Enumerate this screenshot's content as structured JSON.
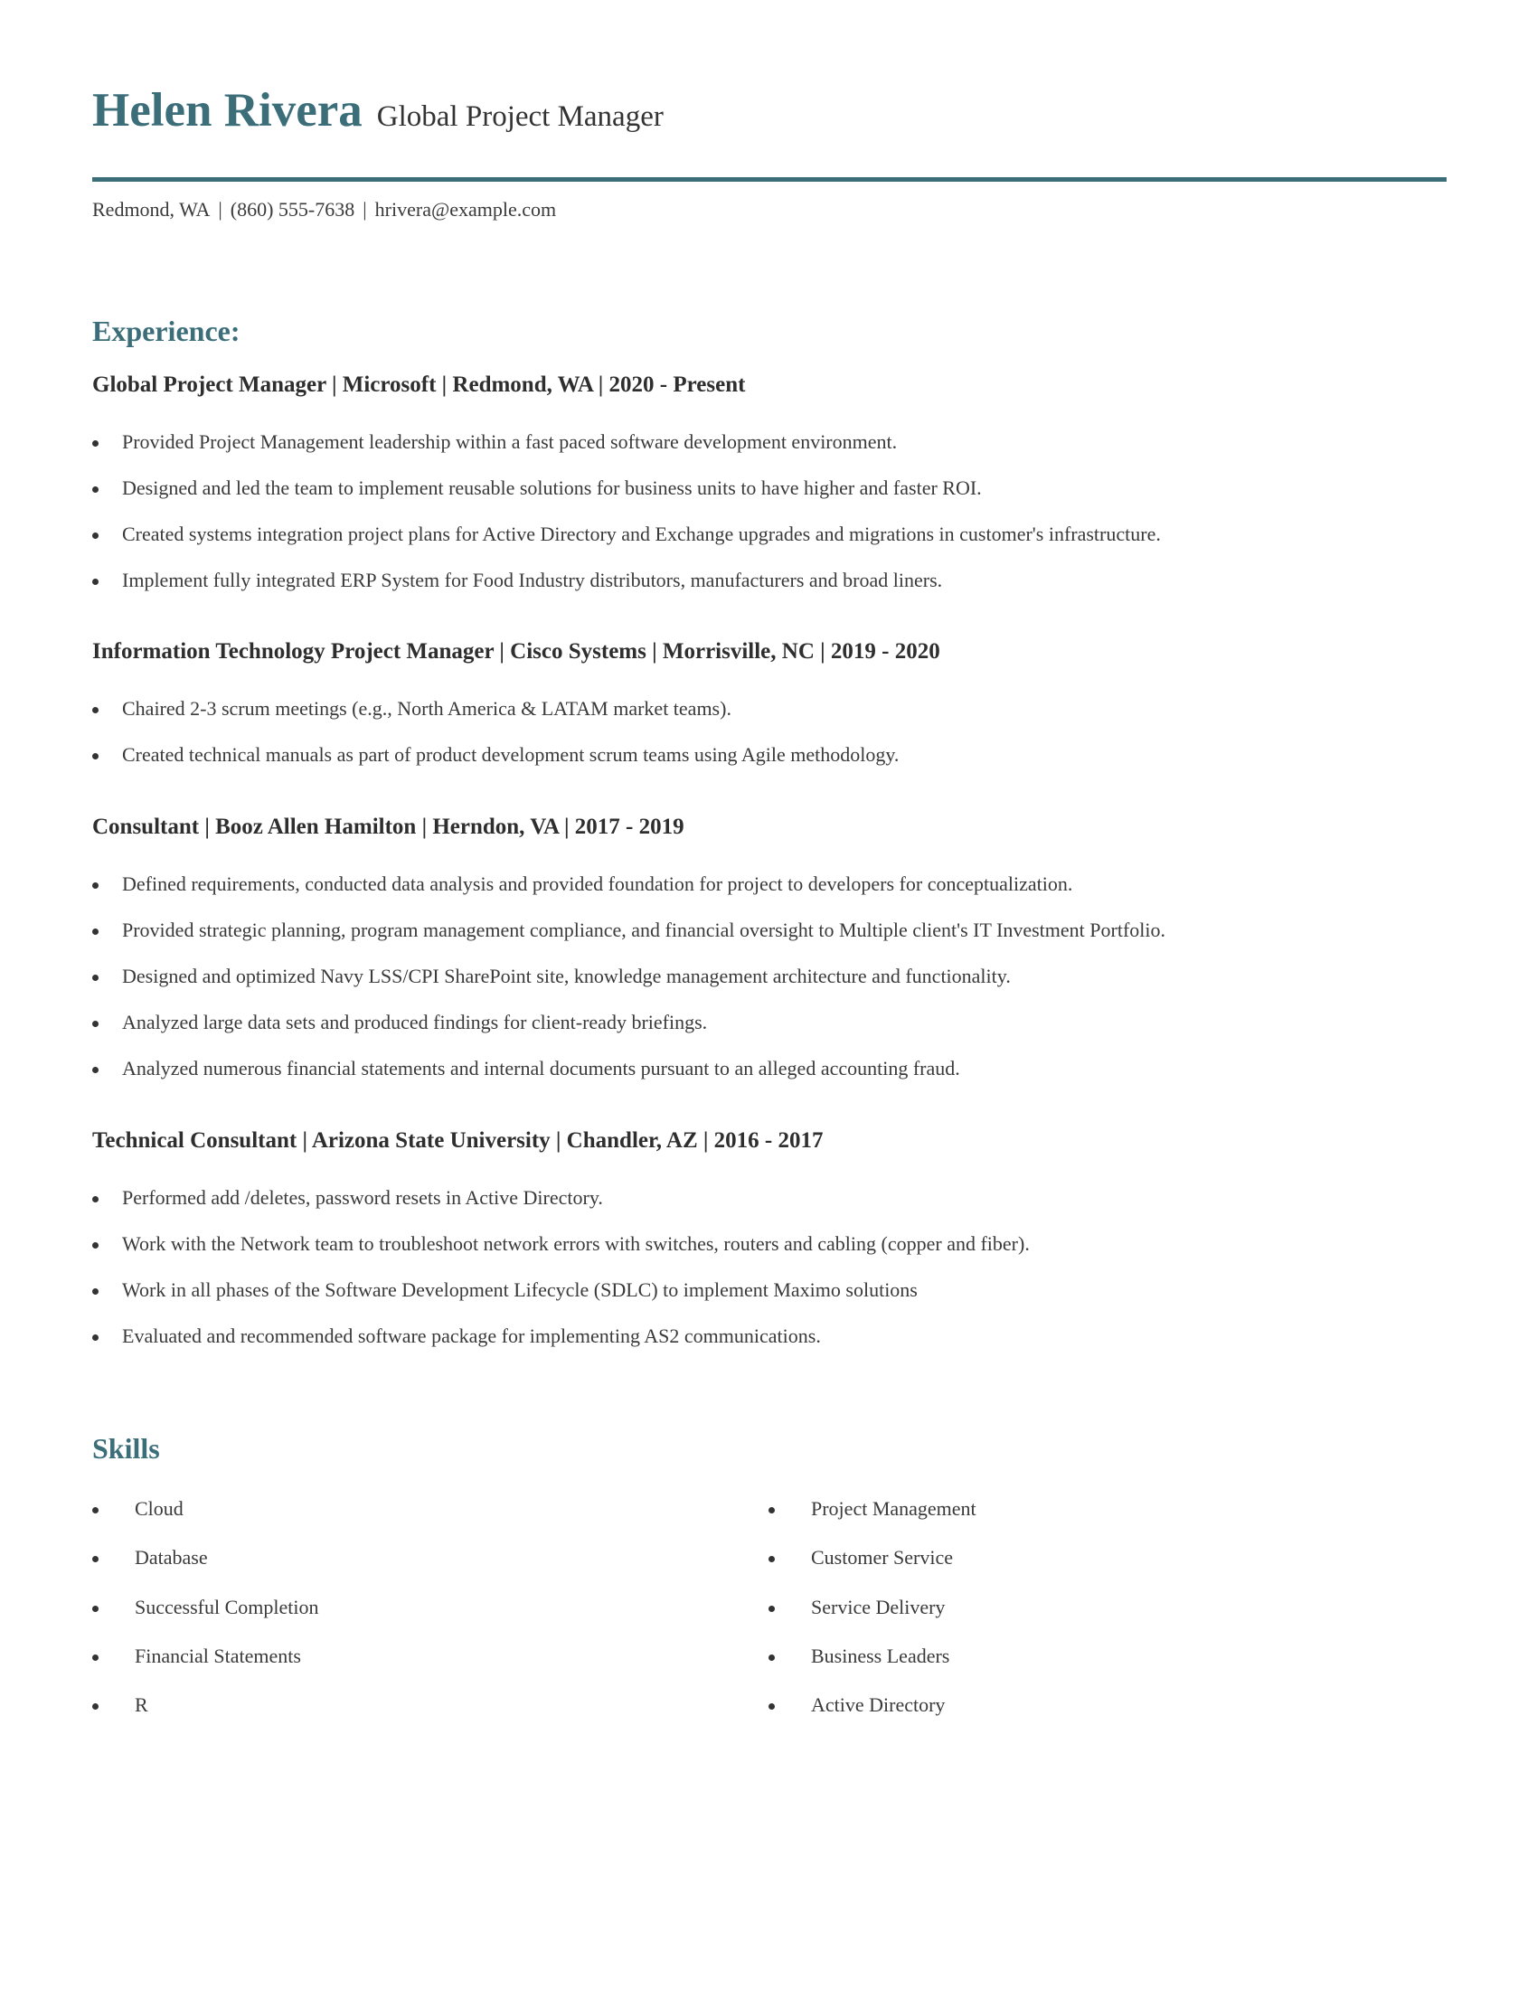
{
  "header": {
    "name": "Helen Rivera",
    "headline": "Global Project Manager",
    "accent_color": "#3c6e7a"
  },
  "contact": {
    "location": "Redmond, WA",
    "separator": "|",
    "phone": "(860) 555-7638",
    "email": "hrivera@example.com"
  },
  "experience": {
    "title": "Experience:",
    "jobs": [
      {
        "heading": "Global Project Manager | Microsoft | Redmond, WA |  2020 - Present",
        "bullets": [
          "Provided Project Management leadership within a fast paced software development environment.",
          "Designed and led the team to implement reusable solutions for business units to have higher and faster ROI.",
          "Created systems integration project plans for Active Directory and Exchange upgrades and migrations in customer's infrastructure.",
          "Implement fully integrated ERP System for Food Industry distributors, manufacturers and broad liners."
        ]
      },
      {
        "heading": "Information Technology Project Manager | Cisco Systems | Morrisville, NC |  2019 - 2020",
        "bullets": [
          "Chaired 2-3 scrum meetings (e.g., North America & LATAM market teams).",
          "Created technical manuals as part of product development scrum teams using Agile methodology."
        ]
      },
      {
        "heading": "Consultant | Booz Allen Hamilton | Herndon, VA |  2017 - 2019",
        "bullets": [
          "Defined requirements, conducted data analysis and provided foundation for project to developers for conceptualization.",
          "Provided strategic planning, program management compliance, and financial oversight to Multiple client's IT Investment Portfolio.",
          "Designed and optimized Navy LSS/CPI SharePoint site, knowledge management architecture and functionality.",
          "Analyzed large data sets and produced findings for client-ready briefings.",
          "Analyzed numerous financial statements and internal documents pursuant to an alleged accounting fraud."
        ]
      },
      {
        "heading": "Technical Consultant | Arizona State University | Chandler, AZ |  2016 - 2017",
        "bullets": [
          "Performed add /deletes, password resets in Active Directory.",
          "Work with the Network team to troubleshoot network errors with switches, routers and cabling (copper and fiber).",
          "Work in all phases of the Software Development Lifecycle (SDLC) to implement Maximo solutions",
          "Evaluated and recommended software package for implementing AS2 communications."
        ]
      }
    ]
  },
  "skills": {
    "title": "Skills",
    "left": [
      "Cloud",
      "Database",
      "Successful Completion",
      "Financial Statements",
      "R"
    ],
    "right": [
      "Project Management",
      "Customer Service",
      "Service Delivery",
      "Business Leaders",
      "Active Directory"
    ]
  }
}
